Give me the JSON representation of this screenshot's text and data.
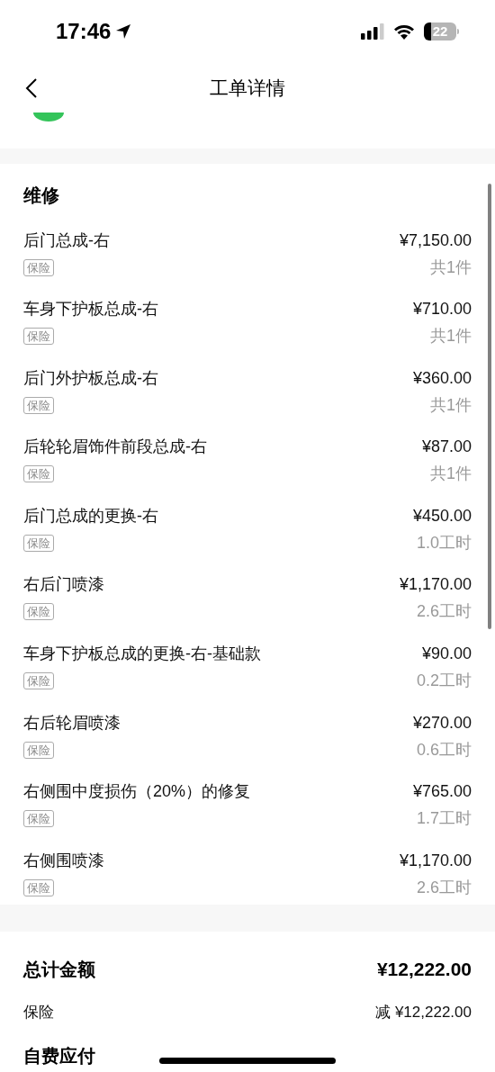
{
  "status_bar": {
    "time": "17:46",
    "battery": "22"
  },
  "nav": {
    "title": "工单详情"
  },
  "section": {
    "title": "维修",
    "items": [
      {
        "name": "后门总成-右",
        "tag": "保险",
        "price": "¥7,150.00",
        "quantity": "共1件"
      },
      {
        "name": "车身下护板总成-右",
        "tag": "保险",
        "price": "¥710.00",
        "quantity": "共1件"
      },
      {
        "name": "后门外护板总成-右",
        "tag": "保险",
        "price": "¥360.00",
        "quantity": "共1件"
      },
      {
        "name": "后轮轮眉饰件前段总成-右",
        "tag": "保险",
        "price": "¥87.00",
        "quantity": "共1件"
      },
      {
        "name": "后门总成的更换-右",
        "tag": "保险",
        "price": "¥450.00",
        "quantity": "1.0工时"
      },
      {
        "name": "右后门喷漆",
        "tag": "保险",
        "price": "¥1,170.00",
        "quantity": "2.6工时"
      },
      {
        "name": "车身下护板总成的更换-右-基础款",
        "tag": "保险",
        "price": "¥90.00",
        "quantity": "0.2工时"
      },
      {
        "name": "右后轮眉喷漆",
        "tag": "保险",
        "price": "¥270.00",
        "quantity": "0.6工时"
      },
      {
        "name": "右侧围中度损伤（20%）的修复",
        "tag": "保险",
        "price": "¥765.00",
        "quantity": "1.7工时"
      },
      {
        "name": "右侧围喷漆",
        "tag": "保险",
        "price": "¥1,170.00",
        "quantity": "2.6工时"
      }
    ]
  },
  "summary": [
    {
      "kind": "total",
      "label": "总计金额",
      "value": "¥12,222.00"
    },
    {
      "kind": "deduction",
      "label": "保险",
      "value": "减 ¥12,222.00"
    },
    {
      "kind": "total",
      "label": "自费应付"
    }
  ]
}
